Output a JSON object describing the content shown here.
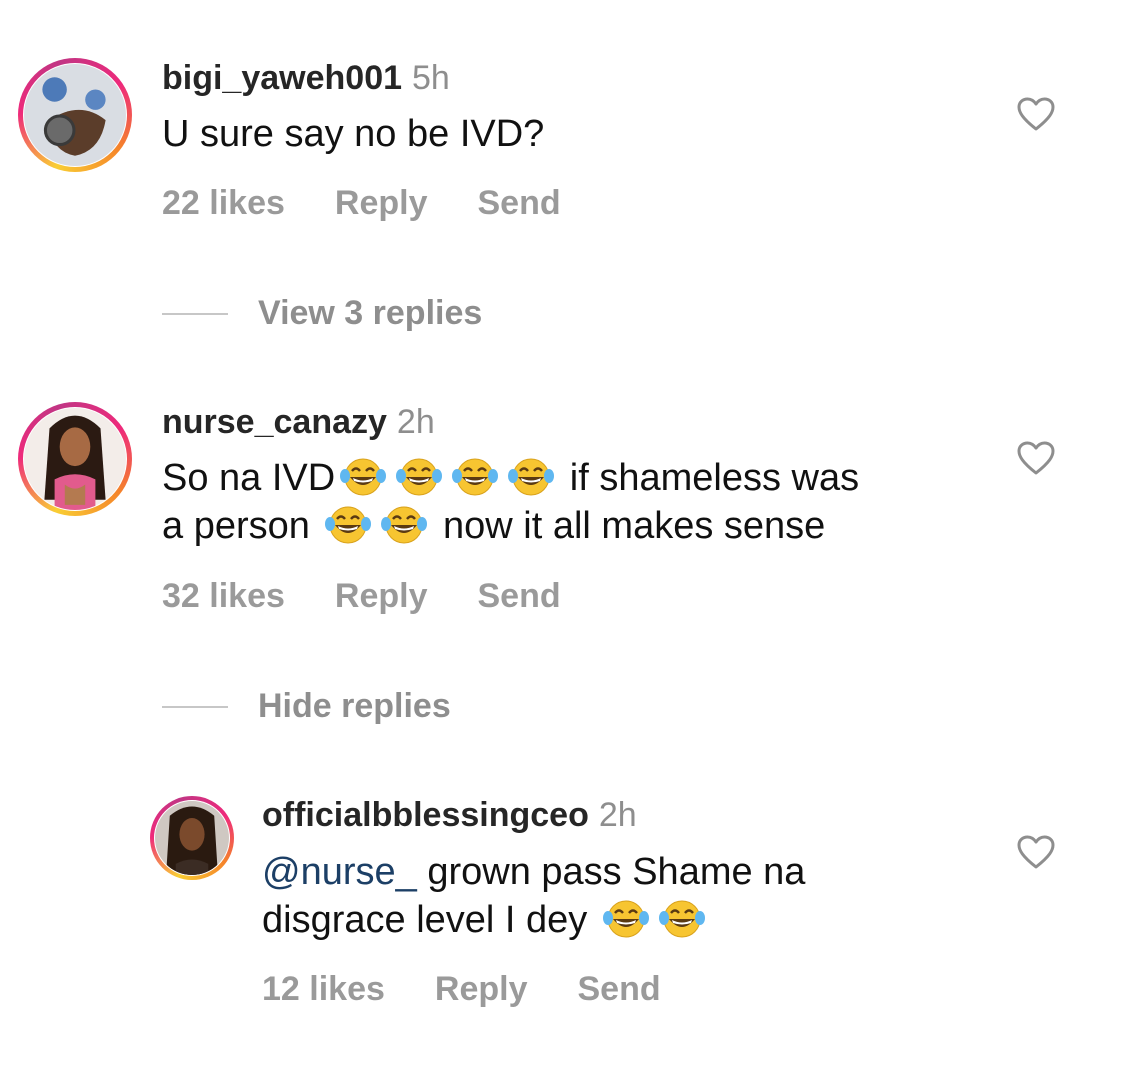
{
  "comments": [
    {
      "username": "bigi_yaweh001",
      "time": "5h",
      "text_parts": [
        "U sure say no be IVD?"
      ],
      "likes": "22 likes",
      "reply": "Reply",
      "send": "Send"
    },
    {
      "username": "nurse_canazy",
      "time": "2h",
      "text_line1_a": "So na IVD",
      "text_line1_b": "if shameless was",
      "text_line2_a": "a person",
      "text_line2_b": "now it all makes sense",
      "likes": "32 likes",
      "reply": "Reply",
      "send": "Send"
    }
  ],
  "reply_comment": {
    "username": "officialbblessingceo",
    "time": "2h",
    "mention": "@nurse_",
    "text_line1_b": "grown pass Shame na",
    "text_line2_a": "disgrace level I dey",
    "likes": "12 likes",
    "reply": "Reply",
    "send": "Send"
  },
  "threads": {
    "view_replies": "View 3 replies",
    "hide_replies": "Hide replies"
  },
  "icons": {
    "heart": "heart-outline-icon",
    "emoji": "face-with-tears-of-joy-emoji"
  },
  "colors": {
    "username": "#262626",
    "secondary": "#8e8e8e",
    "mention": "#1c3f66"
  }
}
